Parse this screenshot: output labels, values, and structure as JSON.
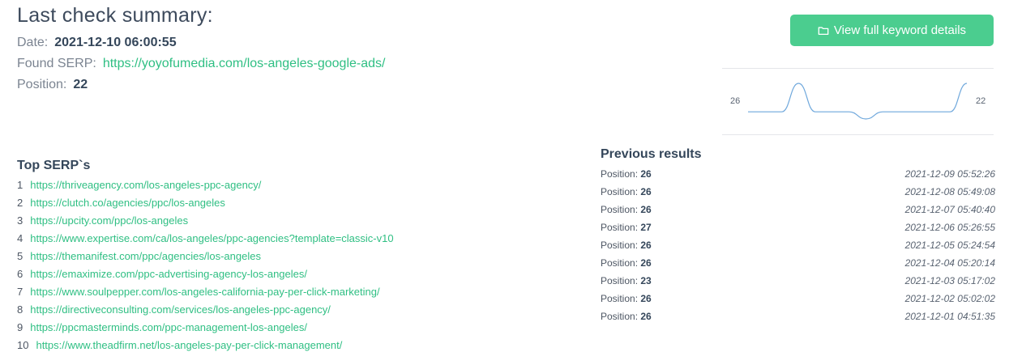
{
  "summary": {
    "title": "Last check summary:",
    "date_label": "Date:",
    "date_value": "2021-12-10 06:00:55",
    "serp_label": "Found SERP:",
    "serp_value": "https://yoyofumedia.com/los-angeles-google-ads/",
    "position_label": "Position:",
    "position_value": "22"
  },
  "button": {
    "label": "View full keyword details",
    "icon": "folder-icon"
  },
  "sparkline": {
    "start_label": "26",
    "end_label": "22",
    "values": [
      26,
      26,
      26,
      22,
      26,
      26,
      26,
      27,
      26,
      26,
      26,
      26,
      26,
      22
    ],
    "color": "#6fa8dc"
  },
  "top_serps": {
    "title": "Top SERP`s",
    "items": [
      {
        "n": "1",
        "url": "https://thriveagency.com/los-angeles-ppc-agency/"
      },
      {
        "n": "2",
        "url": "https://clutch.co/agencies/ppc/los-angeles"
      },
      {
        "n": "3",
        "url": "https://upcity.com/ppc/los-angeles"
      },
      {
        "n": "4",
        "url": "https://www.expertise.com/ca/los-angeles/ppc-agencies?template=classic-v10"
      },
      {
        "n": "5",
        "url": "https://themanifest.com/ppc/agencies/los-angeles"
      },
      {
        "n": "6",
        "url": "https://emaximize.com/ppc-advertising-agency-los-angeles/"
      },
      {
        "n": "7",
        "url": "https://www.soulpepper.com/los-angeles-california-pay-per-click-marketing/"
      },
      {
        "n": "8",
        "url": "https://directiveconsulting.com/services/los-angeles-ppc-agency/"
      },
      {
        "n": "9",
        "url": "https://ppcmasterminds.com/ppc-management-los-angeles/"
      },
      {
        "n": "10",
        "url": "https://www.theadfirm.net/los-angeles-pay-per-click-management/"
      }
    ]
  },
  "previous": {
    "title": "Previous results",
    "label": "Position:",
    "items": [
      {
        "pos": "26",
        "date": "2021-12-09 05:52:26"
      },
      {
        "pos": "26",
        "date": "2021-12-08 05:49:08"
      },
      {
        "pos": "26",
        "date": "2021-12-07 05:40:40"
      },
      {
        "pos": "27",
        "date": "2021-12-06 05:26:55"
      },
      {
        "pos": "26",
        "date": "2021-12-05 05:24:54"
      },
      {
        "pos": "26",
        "date": "2021-12-04 05:20:14"
      },
      {
        "pos": "23",
        "date": "2021-12-03 05:17:02"
      },
      {
        "pos": "26",
        "date": "2021-12-02 05:02:02"
      },
      {
        "pos": "26",
        "date": "2021-12-01 04:51:35"
      }
    ]
  }
}
